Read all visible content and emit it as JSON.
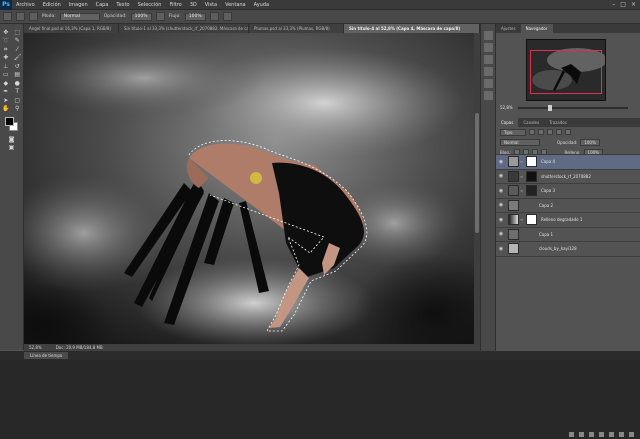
{
  "app": {
    "logo": "Ps"
  },
  "menu": [
    "Archivo",
    "Edición",
    "Imagen",
    "Capa",
    "Texto",
    "Selección",
    "Filtro",
    "3D",
    "Vista",
    "Ventana",
    "Ayuda"
  ],
  "window_controls": [
    "–",
    "□",
    "×"
  ],
  "options_bar": {
    "mode_label": "Modo:",
    "mode_value": "Normal",
    "opacity_label": "Opacidad:",
    "opacity_value": "100%",
    "flow_label": "Flujo:",
    "flow_value": "100%"
  },
  "tabs": [
    {
      "label": "Angel final.psd al 16,3% (Capa 1, RGB/8)",
      "active": false
    },
    {
      "label": "Sin título-1 al 33,3% (shutterstock_rf_2070882, Máscara de capa/8)",
      "active": false
    },
    {
      "label": "Plumas.psd al 33,3% (Plumas, RGB/8)",
      "active": false
    },
    {
      "label": "Sin título-4 al 52,8% (Capa 4, Máscara de capa/8)",
      "active": true
    }
  ],
  "status": {
    "zoom": "52,8%",
    "doc": "Doc: 20,9 MB/184,8 MB"
  },
  "bottom_panel": {
    "label": "Línea de tiempo"
  },
  "panels": {
    "top_tabs": [
      "Ajustes",
      "Navegador"
    ],
    "navigator_zoom": "52,8%",
    "layers_tabs": [
      "Capas",
      "Canales",
      "Trazados"
    ],
    "kind_label": "Tipo",
    "blend_mode": "Normal",
    "opacity_label": "Opacidad:",
    "opacity_value": "100%",
    "lock_label": "Bloq.:",
    "fill_label": "Relleno:",
    "fill_value": "100%"
  },
  "layers": [
    {
      "name": "Capa 4",
      "selected": true,
      "thumb": "#9a9a9a",
      "mask": true
    },
    {
      "name": "shutterstock_rf_2070882",
      "selected": false,
      "thumb": "#3a3a3a",
      "mask": true
    },
    {
      "name": "Capa 3",
      "selected": false,
      "thumb": "#5a5a5a",
      "mask": true
    },
    {
      "name": "Capa 2",
      "selected": false,
      "thumb": "#7b7b7b",
      "mask": false
    },
    {
      "name": "Relleno degradado 1",
      "selected": false,
      "thumb": "#8c8c8c",
      "mask": true
    },
    {
      "name": "Capa 1",
      "selected": false,
      "thumb": "#6e6e6e",
      "mask": false
    },
    {
      "name": "clouds_by_kayi128",
      "selected": false,
      "thumb": "#b5b5b5",
      "mask": false
    }
  ]
}
